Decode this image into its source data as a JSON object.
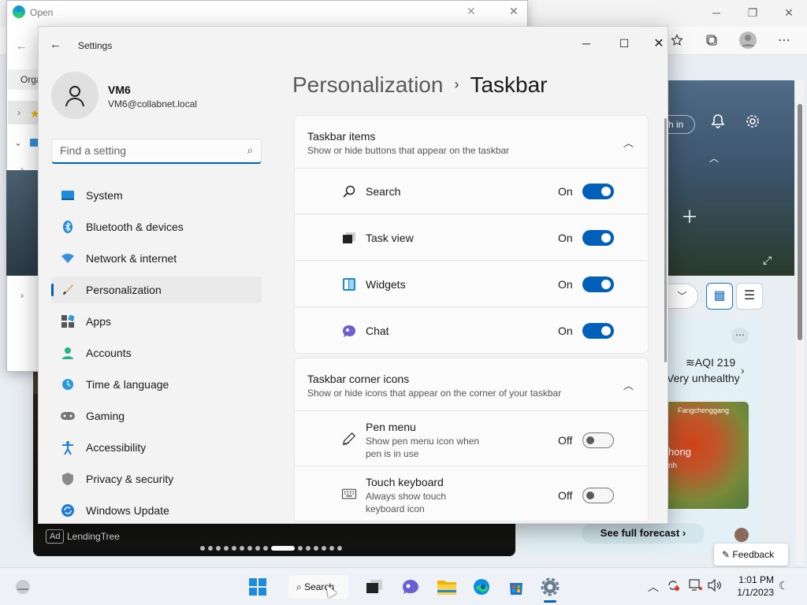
{
  "edge": {
    "win_min": "─",
    "win_max": "❐",
    "win_close": "✕",
    "more": "⋯",
    "ad_badge": "Ad",
    "ad_name": "LendingTree",
    "sign_in": "h in",
    "aqi": "AQI 219",
    "aqi_desc": "Very unhealthy",
    "map_city": "Fangchenggang",
    "map_hong": "hong",
    "map_h": "nh",
    "see_full_forecast": "See full forecast",
    "feedback": "Feedback"
  },
  "open_dialog": {
    "title": "Open",
    "partial_label": "Orga"
  },
  "settings": {
    "title": "Settings",
    "user": {
      "name": "VM6",
      "email": "VM6@collabnet.local"
    },
    "search_placeholder": "Find a setting",
    "nav": [
      {
        "label": "System",
        "icon": "system-icon",
        "selected": false
      },
      {
        "label": "Bluetooth & devices",
        "icon": "bluetooth-icon",
        "selected": false
      },
      {
        "label": "Network & internet",
        "icon": "network-icon",
        "selected": false
      },
      {
        "label": "Personalization",
        "icon": "personalization-icon",
        "selected": true
      },
      {
        "label": "Apps",
        "icon": "apps-icon",
        "selected": false
      },
      {
        "label": "Accounts",
        "icon": "accounts-icon",
        "selected": false
      },
      {
        "label": "Time & language",
        "icon": "time-language-icon",
        "selected": false
      },
      {
        "label": "Gaming",
        "icon": "gaming-icon",
        "selected": false
      },
      {
        "label": "Accessibility",
        "icon": "accessibility-icon",
        "selected": false
      },
      {
        "label": "Privacy & security",
        "icon": "privacy-icon",
        "selected": false
      },
      {
        "label": "Windows Update",
        "icon": "windows-update-icon",
        "selected": false
      }
    ],
    "breadcrumb": {
      "parent": "Personalization",
      "separator": "›",
      "current": "Taskbar"
    },
    "taskbar_items": {
      "title": "Taskbar items",
      "subtitle": "Show or hide buttons that appear on the taskbar",
      "rows": [
        {
          "label": "Search",
          "state": "On",
          "on": true,
          "icon": "search-icon"
        },
        {
          "label": "Task view",
          "state": "On",
          "on": true,
          "icon": "task-view-icon"
        },
        {
          "label": "Widgets",
          "state": "On",
          "on": true,
          "icon": "widgets-icon"
        },
        {
          "label": "Chat",
          "state": "On",
          "on": true,
          "icon": "chat-icon"
        }
      ]
    },
    "corner_icons": {
      "title": "Taskbar corner icons",
      "subtitle": "Show or hide icons that appear on the corner of your taskbar",
      "rows": [
        {
          "label": "Pen menu",
          "desc": "Show pen menu icon when pen is in use",
          "state": "Off",
          "on": false,
          "icon": "pen-icon"
        },
        {
          "label": "Touch keyboard",
          "desc": "Always show touch keyboard icon",
          "state": "Off",
          "on": false,
          "icon": "keyboard-icon"
        }
      ]
    }
  },
  "taskbar": {
    "search_label": "Search",
    "time": "1:01 PM",
    "date": "1/1/2023"
  },
  "colors": {
    "accent": "#005fb8"
  }
}
